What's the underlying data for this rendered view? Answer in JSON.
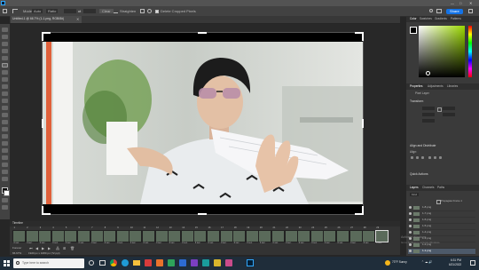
{
  "menu": [
    "File",
    "Edit",
    "Image",
    "Layer",
    "Type",
    "Select",
    "Filter",
    "3D",
    "View",
    "Plugins",
    "Window",
    "Help"
  ],
  "options": {
    "mode_label": "Mode",
    "mode_value": "Auto",
    "ratio_label": "Ratio",
    "clear_label": "Clear",
    "straighten_label": "Straighten",
    "delete_cropped_label": "Delete Cropped Pixels",
    "share_label": "Share"
  },
  "document_tab": "Untitled-1 @ 66.7% (1-1.png, RGB/8#)",
  "right_panel": {
    "color_tabs": [
      "Color",
      "Swatches",
      "Gradients",
      "Patterns"
    ],
    "properties_tabs": [
      "Properties",
      "Adjustments",
      "Libraries"
    ],
    "pixel_layer_label": "Pixel Layer",
    "transform_title": "Transform",
    "align_title": "Align and Distribute",
    "align_sub": "Align:",
    "quick_actions_title": "Quick Actions",
    "layers_tabs": [
      "Layers",
      "Channels",
      "Paths"
    ],
    "layers_filter_label": "Kind",
    "propagate_label": "Propagate Frame 1",
    "layers": [
      "1-8.png",
      "1-7.png",
      "1-6.png",
      "1-5.png",
      "1-4.png",
      "1-3.png",
      "1-2.png",
      "1-1.png"
    ]
  },
  "timeline": {
    "title": "Timeline",
    "frames": [
      "1",
      "2",
      "3",
      "4",
      "5",
      "6",
      "7",
      "8",
      "9",
      "10",
      "11",
      "12",
      "13",
      "14",
      "15",
      "16",
      "17",
      "18",
      "19",
      "20",
      "21",
      "22",
      "23",
      "24",
      "25",
      "26",
      "27",
      "28",
      "29"
    ],
    "frame_delay": "0 sec.",
    "loop_label": "Forever"
  },
  "status_bar": {
    "zoom": "66.67%",
    "size": "1920 px x 1080 px (72 ppi)"
  },
  "taskbar": {
    "search_placeholder": "Type here to search",
    "weather": "73°F Sunny",
    "time": "6:31 PM",
    "date": "6/21/2022"
  },
  "watermark": {
    "line1": "Activate Windows",
    "line2": "Go to Settings to activate Windows."
  },
  "colors": {
    "ps_bg": "#262626",
    "panel": "#3a3a3a",
    "taskbar": "#1f2d3a",
    "accent": "#1473e6",
    "color_picker_hue": "#9bd800"
  }
}
